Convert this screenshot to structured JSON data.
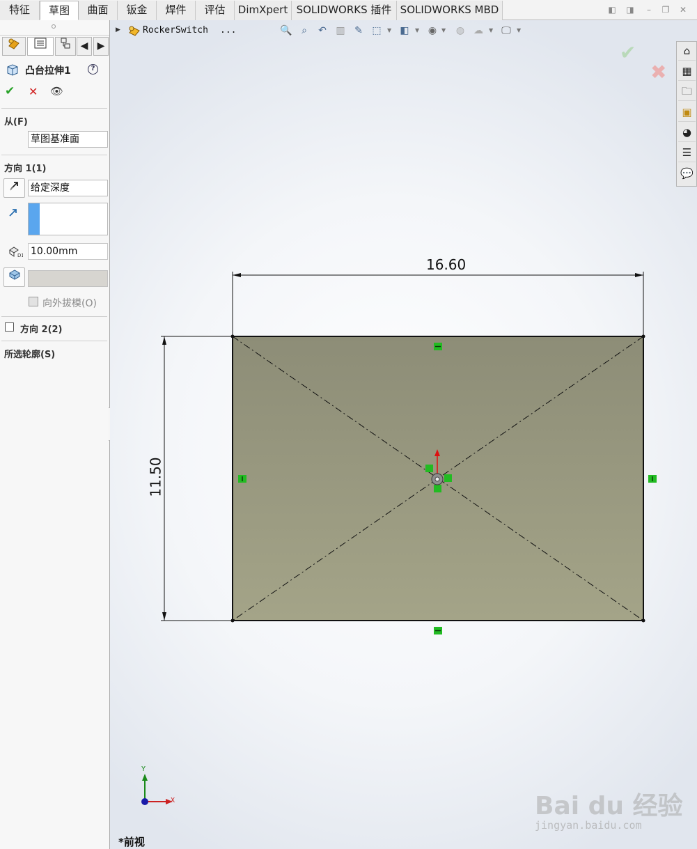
{
  "tabs": [
    "特征",
    "草图",
    "曲面",
    "钣金",
    "焊件",
    "评估",
    "DimXpert",
    "SOLIDWORKS 插件",
    "SOLIDWORKS MBD"
  ],
  "active_tab": "草图",
  "feature_panel": {
    "title": "凸台拉伸1",
    "help_glyph": "?",
    "ok_glyph": "✔",
    "cancel_glyph": "✕",
    "preview_glyph": "👁",
    "from_label": "从(F)",
    "from_value": "草图基准面",
    "direction1_label": "方向 1(1)",
    "end_condition": "给定深度",
    "depth": "10.00mm",
    "draft_outward_label": "向外拔模(O)",
    "direction2_label": "方向 2(2)",
    "selected_contours_label": "所选轮廓(S)"
  },
  "breadcrumb": {
    "part_name": "RockerSwitch",
    "ellipsis": "..."
  },
  "sketch": {
    "width_dim": "16.60",
    "height_dim": "11.50",
    "colors": {
      "fill": "#9a9a80",
      "line": "#111111",
      "relation": "#22bb22"
    }
  },
  "triad": {
    "x_label": "X",
    "y_label": "Y"
  },
  "view_name": "*前视",
  "watermark": {
    "brand": "Bai du 经验",
    "url": "jingyan.baidu.com"
  }
}
